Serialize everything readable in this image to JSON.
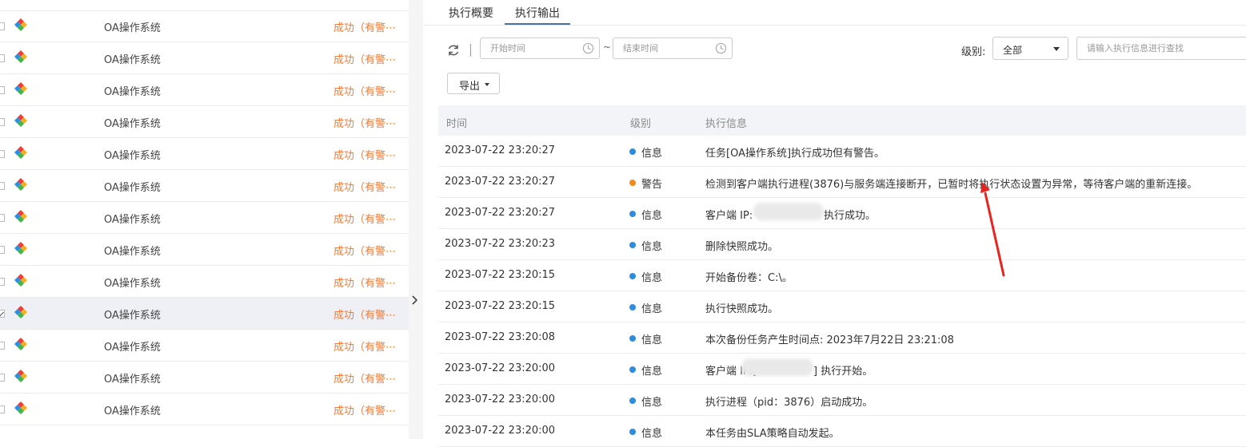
{
  "tabs": [
    "执行概要",
    "执行输出"
  ],
  "toolbar": {
    "start_placeholder": "开始时间",
    "end_placeholder": "结束时间",
    "range_sep": "~",
    "level_label": "级别:",
    "level_value": "全部",
    "search_placeholder": "请输入执行信息进行查找",
    "export_label": "导出"
  },
  "left_list": {
    "rows": [
      {
        "name": "OA操作系统",
        "status": "成功（有警⋯",
        "selected": false
      },
      {
        "name": "OA操作系统",
        "status": "成功（有警⋯",
        "selected": false
      },
      {
        "name": "OA操作系统",
        "status": "成功（有警⋯",
        "selected": false
      },
      {
        "name": "OA操作系统",
        "status": "成功（有警⋯",
        "selected": false
      },
      {
        "name": "OA操作系统",
        "status": "成功（有警⋯",
        "selected": false
      },
      {
        "name": "OA操作系统",
        "status": "成功（有警⋯",
        "selected": false
      },
      {
        "name": "OA操作系统",
        "status": "成功（有警⋯",
        "selected": false
      },
      {
        "name": "OA操作系统",
        "status": "成功（有警⋯",
        "selected": false
      },
      {
        "name": "OA操作系统",
        "status": "成功（有警⋯",
        "selected": false
      },
      {
        "name": "OA操作系统",
        "status": "成功（有警⋯",
        "selected": true
      },
      {
        "name": "OA操作系统",
        "status": "成功（有警⋯",
        "selected": false
      },
      {
        "name": "OA操作系统",
        "status": "成功（有警⋯",
        "selected": false
      },
      {
        "name": "OA操作系统",
        "status": "成功（有警⋯",
        "selected": false
      }
    ]
  },
  "log_table": {
    "headers": [
      "时间",
      "级别",
      "执行信息"
    ],
    "rows": [
      {
        "time": "2023-07-22 23:20:27",
        "level": "信息",
        "msg": "任务[OA操作系统]执行成功但有警告。"
      },
      {
        "time": "2023-07-22 23:20:27",
        "level": "警告",
        "msg": "检测到客户端执行进程(3876)与服务端连接断开，已暂时将执行状态设置为异常，等待客户端的重新连接。"
      },
      {
        "time": "2023-07-22 23:20:27",
        "level": "信息",
        "msg": "客户端 IP:",
        "msg_tail": "执行成功。"
      },
      {
        "time": "2023-07-22 23:20:23",
        "level": "信息",
        "msg": "删除快照成功。"
      },
      {
        "time": "2023-07-22 23:20:15",
        "level": "信息",
        "msg": "开始备份卷：C:\\。"
      },
      {
        "time": "2023-07-22 23:20:15",
        "level": "信息",
        "msg": "执行快照成功。"
      },
      {
        "time": "2023-07-22 23:20:08",
        "level": "信息",
        "msg": "本次备份任务产生时间点: 2023年7月22日 23:21:08"
      },
      {
        "time": "2023-07-22 23:20:00",
        "level": "信息",
        "msg": "客户端 IP:[",
        "msg_tail": "] 执行开始。"
      },
      {
        "time": "2023-07-22 23:20:00",
        "level": "信息",
        "msg": "执行进程（pid：3876）启动成功。"
      },
      {
        "time": "2023-07-22 23:20:00",
        "level": "信息",
        "msg": "本任务由SLA策略自动发起。"
      }
    ]
  },
  "colors": {
    "info_dot": "#2d8ce0",
    "warn_dot": "#f08a1c",
    "status_text": "#f07c3a",
    "arrow": "#e8241f",
    "tab_underline": "#4a6fa5"
  }
}
